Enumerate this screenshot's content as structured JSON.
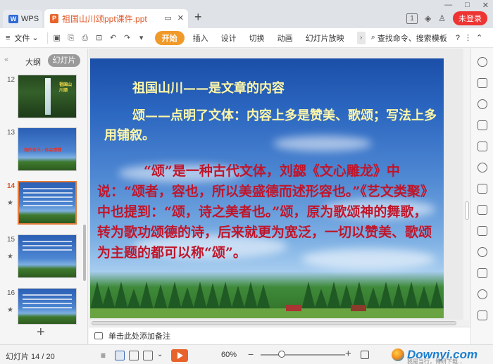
{
  "titlebar": {
    "app_tab": "WPS",
    "doc_title": "祖国山川颂ppt课件.ppt",
    "badge": "1",
    "login": "未登录"
  },
  "toolbar": {
    "file_label": "文件",
    "tabs": [
      "开始",
      "插入",
      "设计",
      "切换",
      "动画",
      "幻灯片放映"
    ],
    "search_label": "查找命令、搜索模板",
    "help": "?"
  },
  "left_panel": {
    "outline_label": "大纲",
    "slides_label": "幻灯片",
    "thumbnails": [
      {
        "num": "12",
        "title": "祖国山川颂",
        "starred": false,
        "selected": false
      },
      {
        "num": "13",
        "starred": false,
        "selected": false
      },
      {
        "num": "14",
        "starred": true,
        "selected": true
      },
      {
        "num": "15",
        "starred": true,
        "selected": false
      },
      {
        "num": "16",
        "starred": true,
        "selected": false
      }
    ]
  },
  "slide": {
    "title": "祖国山川——是文章的内容",
    "line2": "颂——点明了文体：内容上多是赞美、歌颂；写法上多用铺叙。",
    "body": "“颂”是一种古代文体，刘勰《文心雕龙》中说：“颂者，容也，所以美盛德而述形容也。”《艺文类聚》中也提到：“颂，诗之美者也。”颂，原为歌颂神的舞歌，转为歌功颂德的诗，后来就更为宽泛，一切以赞美、歌颂为主题的都可以称“颂”。"
  },
  "notes": {
    "placeholder": "单击此处添加备注"
  },
  "statusbar": {
    "slide_count": "幻灯片 14 / 20",
    "zoom": "60%",
    "zoom_level": 0.25,
    "watermark": "Downyi.com",
    "watermark_sub": "我是当行，博研下载..."
  },
  "colors": {
    "accent": "#f09a2a",
    "title_yellow": "#fff7a8",
    "body_red": "#c0152a"
  }
}
